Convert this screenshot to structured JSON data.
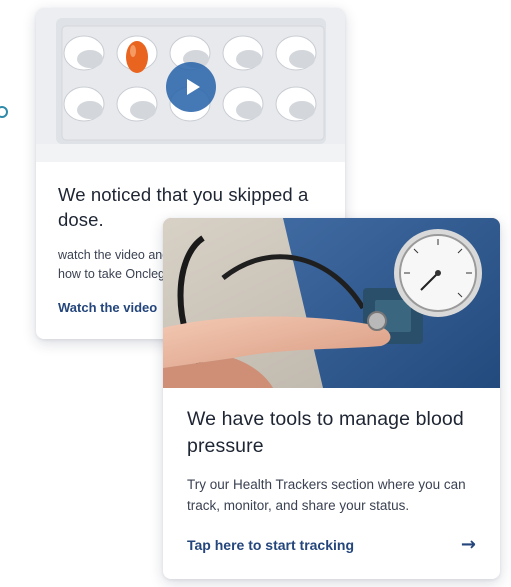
{
  "cards": [
    {
      "title": "We noticed that you skipped a dose.",
      "description": "watch the video and learn how to take Onclegen.",
      "cta_label": "Watch the video",
      "media": {
        "type": "video-thumbnail",
        "subject": "pill-blister-pack",
        "icon": "play-icon",
        "accent": "#2b67ab"
      }
    },
    {
      "title": "We have tools to manage blood pressure",
      "description": "Try our Health Trackers section where you can track, monitor, and share your status.",
      "cta_label": "Tap here to start tracking",
      "cta_icon": "arrow-right-icon",
      "media": {
        "type": "photo",
        "subject": "blood-pressure-gauge"
      }
    }
  ],
  "colors": {
    "link": "#24467c",
    "title": "#1e2533",
    "body": "#3b4252",
    "side_indicator": "#2d8aa8"
  }
}
